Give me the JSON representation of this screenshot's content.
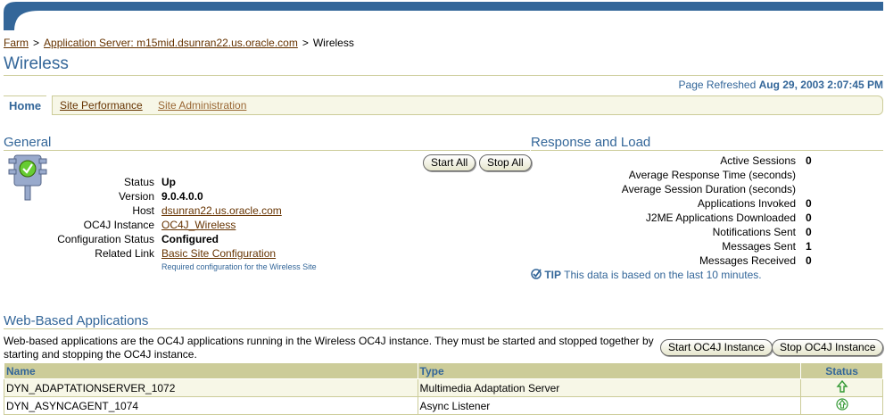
{
  "breadcrumb": {
    "items": [
      "Farm",
      "Application Server: m15mid.dsunran22.us.oracle.com"
    ],
    "separator": ">",
    "current": "Wireless"
  },
  "page": {
    "title": "Wireless",
    "refreshed_label": "Page Refreshed",
    "refreshed_value": "Aug 29, 2003 2:07:45 PM"
  },
  "tabs": {
    "home": "Home",
    "site_performance": "Site Performance",
    "site_administration": "Site Administration"
  },
  "general": {
    "heading": "General",
    "status_icon": "traffic-light-icon",
    "start_all": "Start All",
    "stop_all": "Stop All",
    "rows": [
      {
        "label": "Status",
        "value": "Up"
      },
      {
        "label": "Version",
        "value": "9.0.4.0.0"
      },
      {
        "label": "Host",
        "value": "dsunran22.us.oracle.com"
      },
      {
        "label": "OC4J Instance",
        "value": "OC4J_Wireless"
      },
      {
        "label": "Configuration Status",
        "value": "Configured"
      },
      {
        "label": "Related Link",
        "value": "Basic Site Configuration"
      }
    ],
    "related_note": "Required configuration for the Wireless Site"
  },
  "response_load": {
    "heading": "Response and Load",
    "rows": [
      {
        "label": "Active Sessions",
        "value": "0"
      },
      {
        "label": "Average Response Time (seconds)",
        "value": ""
      },
      {
        "label": "Average Session Duration (seconds)",
        "value": ""
      },
      {
        "label": "Applications Invoked",
        "value": "0"
      },
      {
        "label": "J2ME Applications Downloaded",
        "value": "0"
      },
      {
        "label": "Notifications Sent",
        "value": "0"
      },
      {
        "label": "Messages Sent",
        "value": "1"
      },
      {
        "label": "Messages Received",
        "value": "0"
      }
    ],
    "tip_label": "TIP",
    "tip_text": "This data is based on the last 10 minutes."
  },
  "web_apps": {
    "heading": "Web-Based Applications",
    "description": "Web-based applications are the OC4J applications running in the Wireless OC4J instance. They must be started and stopped together by starting and stopping the OC4J instance.",
    "start_button": "Start OC4J Instance",
    "stop_button": "Stop OC4J Instance",
    "columns": [
      "Name",
      "Type",
      "Status"
    ],
    "rows": [
      {
        "name": "DYN_ADAPTATIONSERVER_1072",
        "type": "Multimedia Adaptation Server",
        "status": "up-arrow-icon"
      },
      {
        "name": "DYN_ASYNCAGENT_1074",
        "type": "Async Listener",
        "status": "up-arrow-icon"
      }
    ]
  },
  "colors": {
    "brand_blue": "#336699",
    "link_brown": "#663300",
    "table_header": "#cccc99",
    "row_tint": "#f7f7e7",
    "status_up": "#339933"
  }
}
